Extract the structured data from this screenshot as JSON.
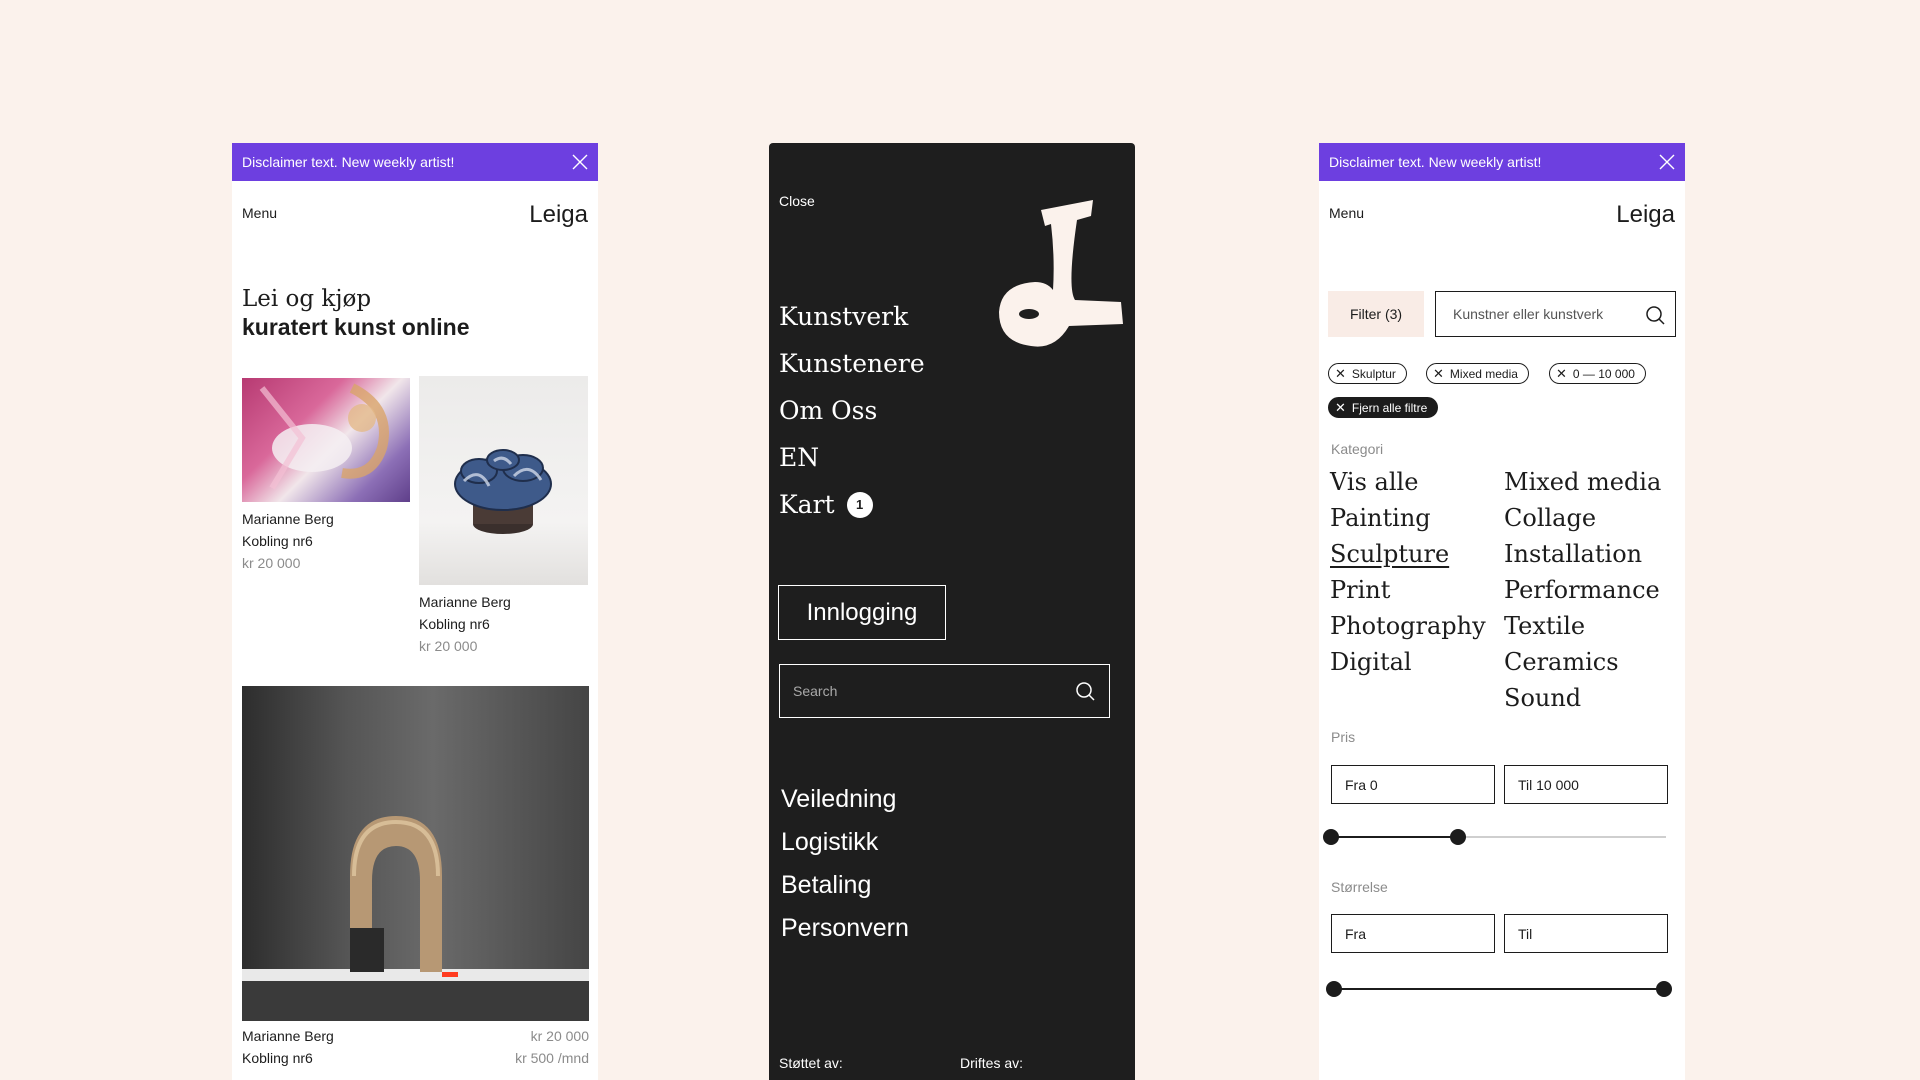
{
  "colors": {
    "background": "#fbf2ec",
    "banner": "#6d3fe0",
    "dark_panel": "#1e1e1e",
    "filter_button": "#f9ece6"
  },
  "banner_text": "Disclaimer text. New weekly artist!",
  "menu_label": "Menu",
  "logo_text": "Leiga",
  "home": {
    "hero_line1": "Lei og kjøp",
    "hero_line2": "kuratert kunst online",
    "artworks": [
      {
        "artist": "Marianne Berg",
        "title": "Kobling nr6",
        "price": "kr 20 000"
      },
      {
        "artist": "Marianne Berg",
        "title": "Kobling nr6",
        "price": "kr 20 000"
      },
      {
        "artist": "Marianne Berg",
        "title": "Kobling nr6",
        "price": "kr 20 000",
        "rent": "kr 500 /mnd"
      }
    ]
  },
  "menu_panel": {
    "close_label": "Close",
    "nav": [
      "Kunstverk",
      "Kunstenere",
      "Om Oss",
      "EN",
      "Kart"
    ],
    "cart_count": "1",
    "login_label": "Innlogging",
    "search_placeholder": "Search",
    "links": [
      "Veiledning",
      "Logistikk",
      "Betaling",
      "Personvern"
    ],
    "supported_by": "Støttet av:",
    "run_by": "Driftes av:"
  },
  "filters": {
    "filter_button": "Filter (3)",
    "search_placeholder": "Kunstner eller kunstverk",
    "chips": [
      "Skulptur",
      "Mixed media",
      "0 — 10 000"
    ],
    "clear_all": "Fjern alle filtre",
    "category_heading": "Kategori",
    "categories_left": [
      "Vis alle",
      "Painting",
      "Sculpture",
      "Print",
      "Photography",
      "Digital"
    ],
    "categories_right": [
      "Mixed media",
      "Collage",
      "Installation",
      "Performance",
      "Textile",
      "Ceramics",
      "Sound"
    ],
    "active_category": "Sculpture",
    "price_heading": "Pris",
    "price_from": "Fra 0",
    "price_to": "Til 10 000",
    "price_range_fraction": [
      0.0,
      0.38
    ],
    "size_heading": "Størrelse",
    "size_from": "Fra",
    "size_to": "Til",
    "size_range_fraction": [
      0.0,
      1.0
    ]
  }
}
